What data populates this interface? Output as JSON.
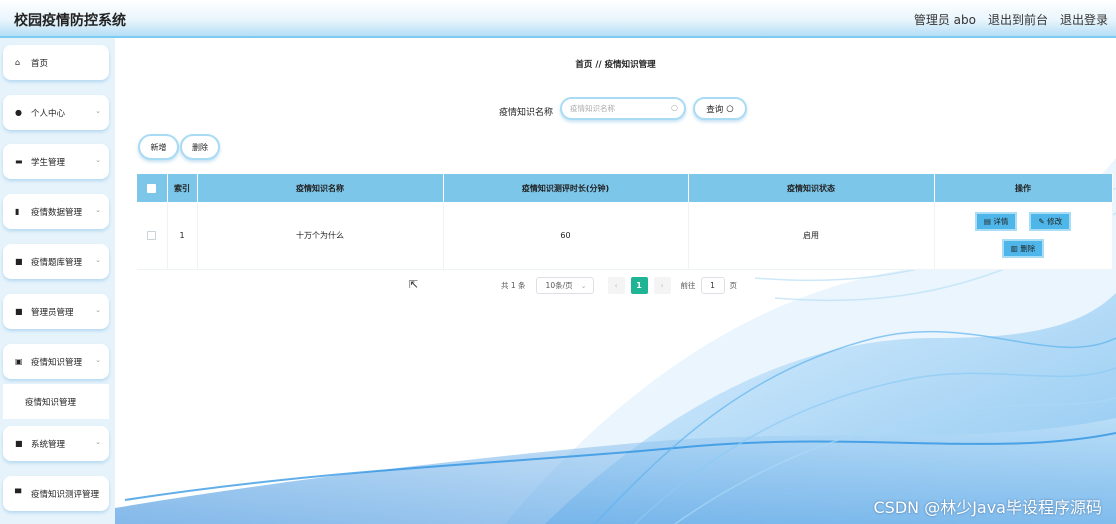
{
  "header": {
    "app_title": "校园疫情防控系统",
    "role_label": "管理员 abo",
    "to_front_label": "退出到前台",
    "logout_label": "退出登录"
  },
  "sidebar": {
    "items": [
      {
        "label": "首页",
        "icon": "home-icon"
      },
      {
        "label": "个人中心",
        "icon": "user-icon"
      },
      {
        "label": "学生管理",
        "icon": "briefcase-icon"
      },
      {
        "label": "疫情数据管理",
        "icon": "bar-chart-icon"
      },
      {
        "label": "疫情题库管理",
        "icon": "grid-icon"
      },
      {
        "label": "管理员管理",
        "icon": "grid-icon"
      },
      {
        "label": "疫情知识管理",
        "icon": "clipboard-icon"
      },
      {
        "label": "系统管理",
        "icon": "grid-icon"
      },
      {
        "label": "疫情知识测评管理",
        "icon": "monitor-icon"
      }
    ],
    "submenu_label": "疫情知识管理"
  },
  "breadcrumb": {
    "home": "首页",
    "separator": "//",
    "current": "疫情知识管理"
  },
  "search": {
    "label": "疫情知识名称",
    "placeholder": "疫情知识名称",
    "button_label": "查询"
  },
  "toolbar": {
    "add_label": "新增",
    "delete_label": "删除"
  },
  "table": {
    "headers": [
      "索引",
      "疫情知识名称",
      "疫情知识测评时长(分钟)",
      "疫情知识状态",
      "操作"
    ],
    "rows": [
      {
        "index": "1",
        "name": "十万个为什么",
        "duration": "60",
        "status": "启用"
      }
    ],
    "actions": {
      "detail": "详情",
      "edit": "修改",
      "delete": "删除"
    }
  },
  "pagination": {
    "total_text": "共 1 条",
    "page_size_text": "10条/页",
    "current_page": "1",
    "goto_label": "前往",
    "goto_value": "1",
    "page_suffix": "页"
  },
  "watermark": "CSDN @林少Java毕设程序源码",
  "colors": {
    "accent": "#7cc6ea",
    "button": "#4fb6e9",
    "pager_active": "#1fb594"
  }
}
